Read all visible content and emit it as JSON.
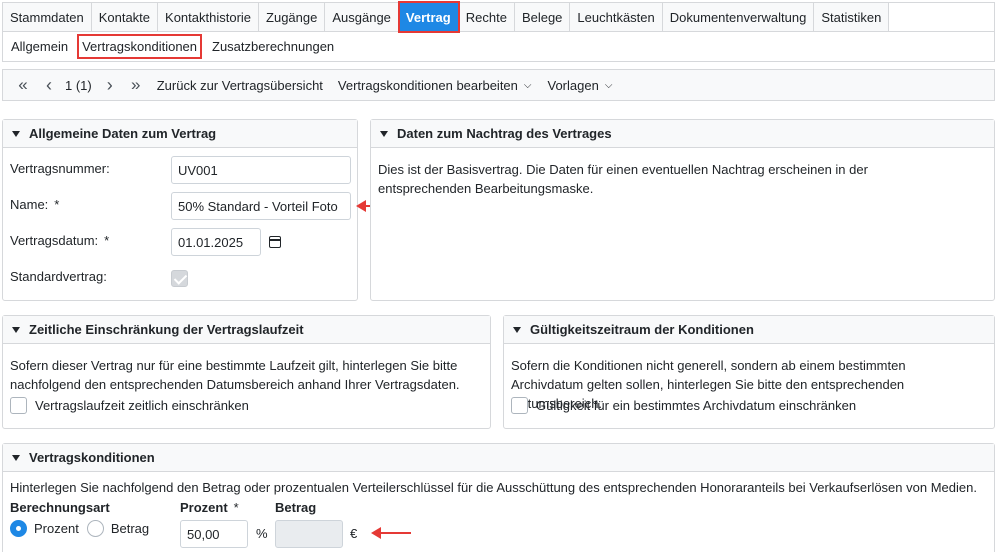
{
  "tabs": [
    "Stammdaten",
    "Kontakte",
    "Kontakthistorie",
    "Zugänge",
    "Ausgänge",
    "Vertrag",
    "Rechte",
    "Belege",
    "Leuchtkästen",
    "Dokumentenverwaltung",
    "Statistiken"
  ],
  "active_tab": "Vertrag",
  "subtabs": [
    "Allgemein",
    "Vertragskonditionen",
    "Zusatzberechnungen"
  ],
  "active_subtab": "Vertragskonditionen",
  "toolbar": {
    "first_icon": "«",
    "prev_icon": "‹",
    "page": "1 (1)",
    "next_icon": "›",
    "last_icon": "»",
    "back": "Zurück zur Vertragsübersicht",
    "edit": "Vertragskonditionen bearbeiten",
    "templates": "Vorlagen"
  },
  "general": {
    "title": "Allgemeine Daten zum Vertrag",
    "number_label": "Vertragsnummer:",
    "number_value": "UV001",
    "name_label": "Name:",
    "name_value": "50% Standard - Vorteil Foto",
    "date_label": "Vertragsdatum:",
    "date_value": "01.01.2025",
    "standard_label": "Standardvertrag:",
    "required_mark": "*"
  },
  "addendum": {
    "title": "Daten zum Nachtrag des Vertrages",
    "text": "Dies ist der Basisvertrag. Die Daten für einen eventuellen Nachtrag erscheinen in der entsprechenden Bearbeitungsmaske."
  },
  "term": {
    "title": "Zeitliche Einschränkung der Vertragslaufzeit",
    "text": "Sofern dieser Vertrag nur für eine bestimmte Laufzeit gilt, hinterlegen Sie bitte nachfolgend den entsprechenden Datumsbereich anhand Ihrer Vertragsdaten.",
    "checkbox": "Vertragslaufzeit zeitlich einschränken"
  },
  "validity": {
    "title": "Gültigkeitszeitraum der Konditionen",
    "text": "Sofern die Konditionen nicht generell, sondern ab einem bestimmten Archivdatum gelten sollen, hinterlegen Sie bitte den entsprechenden Datumsbereich.",
    "checkbox": "Gültigkeit für ein bestimmtes Archivdatum einschränken"
  },
  "conditions": {
    "title": "Vertragskonditionen",
    "text": "Hinterlegen Sie nachfolgend den Betrag oder prozentualen Verteilerschlüssel für die Ausschüttung des entsprechenden Honoraranteils bei Verkaufserlösen von Medien.",
    "calc_label": "Berechnungsart",
    "opt_percent": "Prozent",
    "opt_amount": "Betrag",
    "percent_label": "Prozent",
    "percent_value": "50,00",
    "percent_unit": "%",
    "amount_label": "Betrag",
    "amount_unit": "€",
    "required_mark": "*"
  },
  "colors": {
    "active_tab": "#1e88e5",
    "highlight": "#e53935"
  }
}
